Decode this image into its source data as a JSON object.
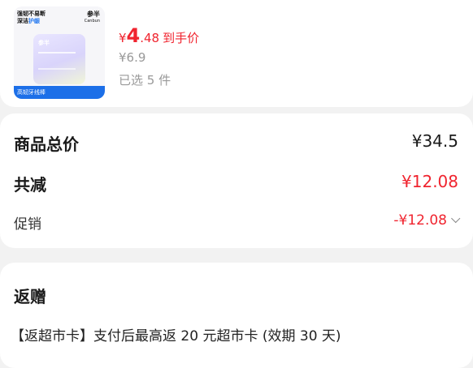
{
  "product": {
    "image_tag_line1": "强韧不易断",
    "image_tag_line2a": "深洁",
    "image_tag_line2b": "护龈",
    "image_brand": "参半",
    "image_brand_sub": "Canbun",
    "image_bottom_label": "高韧牙线棒",
    "price_symbol": "¥",
    "price_integer": "4",
    "price_decimal": ".48",
    "price_label": "到手价",
    "original_price": "¥6.9",
    "selected_qty": "已选 5 件"
  },
  "summary": {
    "total_label": "商品总价",
    "total_value": "¥34.5",
    "reduce_label": "共减",
    "reduce_value": "¥12.08",
    "promo_label": "促销",
    "promo_value": "-¥12.08"
  },
  "rebate": {
    "title": "返赠",
    "description": "【返超市卡】支付后最高返 20 元超市卡 (效期 30 天)"
  },
  "colors": {
    "accent_red": "#f0242f",
    "muted": "#999999",
    "background": "#f2f2f2"
  }
}
